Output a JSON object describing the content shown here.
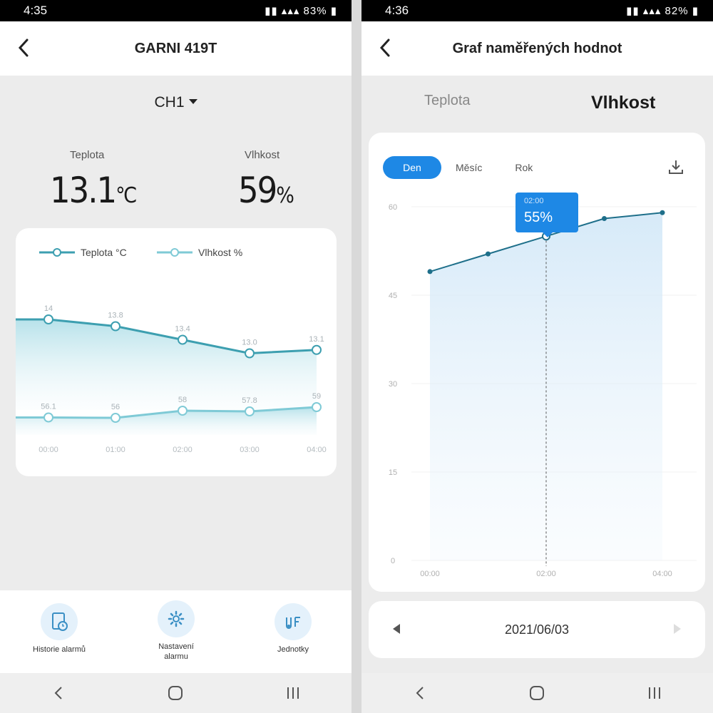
{
  "left_screen": {
    "status": {
      "time": "4:35",
      "battery": "83%"
    },
    "appbar": {
      "title": "GARNI 419T"
    },
    "channel": "CH1",
    "temperature": {
      "label": "Teplota",
      "value": "13.1",
      "unit": "℃"
    },
    "humidity": {
      "label": "Vlhkost",
      "value": "59",
      "unit": "%"
    },
    "legend": {
      "temp": "Teplota °C",
      "hum": "Vlhkost %"
    },
    "actions": [
      {
        "label": "Historie alarmů",
        "icon": "clock-doc-icon"
      },
      {
        "label": "Nastavení alarmu",
        "icon": "gear-icon"
      },
      {
        "label": "Jednotky",
        "icon": "units-icon"
      }
    ]
  },
  "right_screen": {
    "status": {
      "time": "4:36",
      "battery": "82%"
    },
    "appbar": {
      "title": "Graf naměřených hodnot"
    },
    "tabs": {
      "temp": "Teplota",
      "hum": "Vlhkost"
    },
    "periods": {
      "day": "Den",
      "month": "Měsíc",
      "year": "Rok"
    },
    "tooltip": {
      "time": "02:00",
      "value": "55%"
    },
    "date": "2021/06/03"
  },
  "chart_data": [
    {
      "type": "line",
      "x": [
        "00:00",
        "01:00",
        "02:00",
        "03:00",
        "04:00"
      ],
      "series": [
        {
          "name": "Teplota °C",
          "values": [
            14,
            13.8,
            13.4,
            13.0,
            13.1
          ],
          "labels": [
            "14",
            "13.8",
            "13.4",
            "13.0",
            "13.1"
          ],
          "color": "#3d9fb0"
        },
        {
          "name": "Vlhkost %",
          "values": [
            56.1,
            56,
            58,
            57.8,
            59
          ],
          "labels": [
            "56.1",
            "56",
            "58",
            "57.8",
            "59"
          ],
          "color": "#7fcad6"
        }
      ],
      "legend": "top-left",
      "grid": false
    },
    {
      "type": "area",
      "x": [
        "00:00",
        "01:00",
        "02:00",
        "03:00",
        "04:00"
      ],
      "values": [
        49,
        52,
        55,
        58,
        59
      ],
      "xticks": [
        "00:00",
        "02:00",
        "04:00"
      ],
      "yticks": [
        "0",
        "15",
        "30",
        "45",
        "60"
      ],
      "ylim": [
        0,
        60
      ],
      "grid": true,
      "color": "#1e6f8a"
    }
  ]
}
